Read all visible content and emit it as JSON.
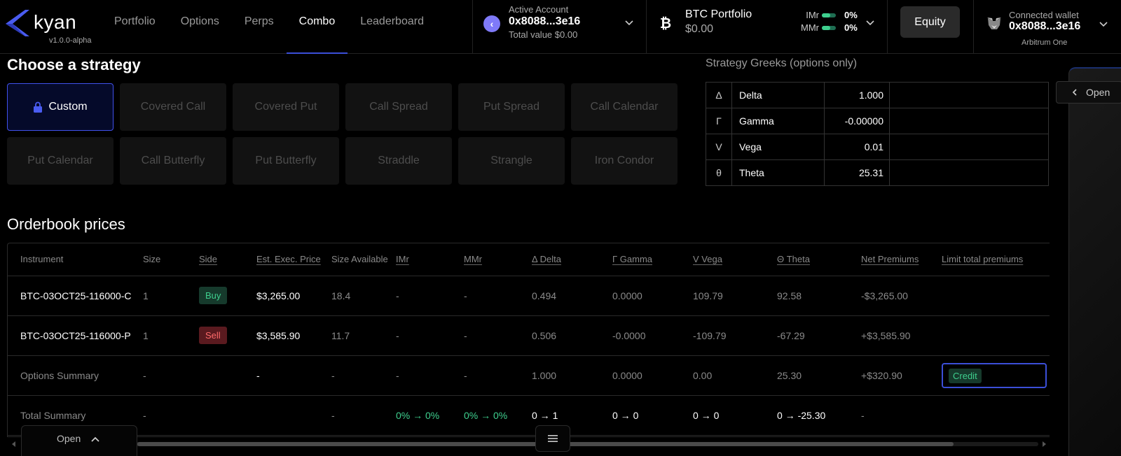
{
  "brand": {
    "name": "kyan",
    "version": "v1.0.0-alpha",
    "accent": "#3b4fd8"
  },
  "nav": {
    "items": [
      {
        "label": "Portfolio"
      },
      {
        "label": "Options"
      },
      {
        "label": "Perps"
      },
      {
        "label": "Combo",
        "active": true
      },
      {
        "label": "Leaderboard"
      }
    ]
  },
  "account": {
    "label": "Active Account",
    "address": "0x8088...3e16",
    "total": "Total value $0.00"
  },
  "btc_portfolio": {
    "title": "BTC Portfolio",
    "value": "$0.00",
    "imr_label": "IMr",
    "imr_value": "0%",
    "mmr_label": "MMr",
    "mmr_value": "0%"
  },
  "equity_button": "Equity",
  "wallet": {
    "label": "Connected wallet",
    "address": "0x8088...3e16",
    "network": "Arbitrum One"
  },
  "strategy": {
    "title": "Choose a strategy",
    "options": [
      {
        "label": "Custom",
        "active": true
      },
      {
        "label": "Covered Call"
      },
      {
        "label": "Covered Put"
      },
      {
        "label": "Call Spread"
      },
      {
        "label": "Put Spread"
      },
      {
        "label": "Call Calendar"
      },
      {
        "label": "Put Calendar"
      },
      {
        "label": "Call Butterfly"
      },
      {
        "label": "Put Butterfly"
      },
      {
        "label": "Straddle"
      },
      {
        "label": "Strangle"
      },
      {
        "label": "Iron Condor"
      }
    ]
  },
  "greeks": {
    "title": "Strategy Greeks (options only)",
    "rows": [
      {
        "symbol": "Δ",
        "name": "Delta",
        "value": "1.000"
      },
      {
        "symbol": "Γ",
        "name": "Gamma",
        "value": "-0.00000"
      },
      {
        "symbol": "V",
        "name": "Vega",
        "value": "0.01"
      },
      {
        "symbol": "θ",
        "name": "Theta",
        "value": "25.31"
      }
    ]
  },
  "side_panel": {
    "open_label": "Open"
  },
  "orderbook": {
    "title": "Orderbook prices",
    "headers": {
      "instrument": "Instrument",
      "size": "Size",
      "side": "Side",
      "exec_price": "Est. Exec. Price",
      "size_available": "Size Available",
      "imr": "IMr",
      "mmr": "MMr",
      "delta": "Δ Delta",
      "gamma": "Γ Gamma",
      "vega": "V Vega",
      "theta": "Θ Theta",
      "net_premiums": "Net Premiums",
      "limit_total": "Limit total premiums"
    },
    "rows": [
      {
        "instrument": "BTC-03OCT25-116000-C",
        "size": "1",
        "side": "Buy",
        "exec_price": "$3,265.00",
        "size_available": "18.4",
        "imr": "-",
        "mmr": "-",
        "delta": "0.494",
        "gamma": "0.0000",
        "vega": "109.79",
        "theta": "92.58",
        "net_premiums": "-$3,265.00"
      },
      {
        "instrument": "BTC-03OCT25-116000-P",
        "size": "1",
        "side": "Sell",
        "exec_price": "$3,585.90",
        "size_available": "11.7",
        "imr": "-",
        "mmr": "-",
        "delta": "0.506",
        "gamma": "-0.0000",
        "vega": "-109.79",
        "theta": "-67.29",
        "net_premiums": "+$3,585.90"
      }
    ],
    "options_summary": {
      "label": "Options Summary",
      "size": "-",
      "exec_price": "-",
      "size_available": "-",
      "imr": "-",
      "mmr": "-",
      "delta": "1.000",
      "gamma": "0.0000",
      "vega": "0.00",
      "theta": "25.30",
      "net_premiums": "+$320.90",
      "limit_badge": "Credit"
    },
    "total_summary": {
      "label": "Total Summary",
      "size": "-",
      "size_available": "-",
      "imr": "0% → 0%",
      "mmr": "0% → 0%",
      "delta": "0 → 1",
      "gamma": "0 → 0",
      "vega": "0 → 0",
      "theta": "0 → -25.30",
      "net_premiums": "-"
    }
  },
  "bottom": {
    "open_label": "Open"
  }
}
